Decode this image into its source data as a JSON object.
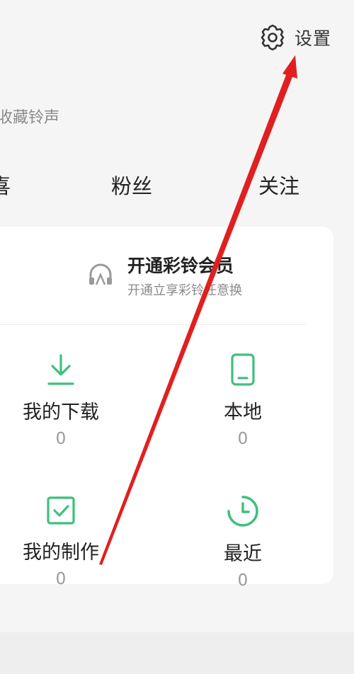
{
  "header": {
    "settings_label": "设置"
  },
  "profile": {
    "subtitle": "收藏铃声"
  },
  "stats": [
    {
      "label": "喜"
    },
    {
      "label": "粉丝"
    },
    {
      "label": "关注"
    }
  ],
  "vip": {
    "title": "开通彩铃会员",
    "description": "开通立享彩铃任意换"
  },
  "grid": [
    {
      "label": "我的下载",
      "count": "0",
      "icon": "download-icon"
    },
    {
      "label": "本地",
      "count": "0",
      "icon": "phone-icon"
    },
    {
      "label": "我的制作",
      "count": "0",
      "icon": "checkbox-icon"
    },
    {
      "label": "最近",
      "count": "0",
      "icon": "clock-icon"
    }
  ],
  "colors": {
    "accent_green": "#3ec07d",
    "annotation_red": "#e02020"
  }
}
